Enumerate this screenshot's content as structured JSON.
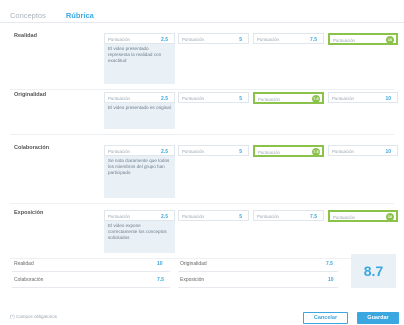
{
  "tabs": [
    {
      "label": "Conceptos"
    },
    {
      "label": "Rúbrica"
    }
  ],
  "criteria": [
    {
      "name": "Realidad",
      "levels": [
        {
          "label": "Puntuación",
          "value": "2.5",
          "desc": "El video presentado representa la realidad con exactitud"
        },
        {
          "label": "Puntuación",
          "value": "5"
        },
        {
          "label": "Puntuación",
          "value": "7.5"
        },
        {
          "label": "Puntuación",
          "value": "10"
        }
      ],
      "selected": 3
    },
    {
      "name": "Originalidad",
      "levels": [
        {
          "label": "Puntuación",
          "value": "2.5",
          "desc": "El video presentado es original"
        },
        {
          "label": "Puntuación",
          "value": "5"
        },
        {
          "label": "Puntuación",
          "value": "7.5"
        },
        {
          "label": "Puntuación",
          "value": "10"
        }
      ],
      "selected": 2
    },
    {
      "name": "Colaboración",
      "levels": [
        {
          "label": "Puntuación",
          "value": "2.5",
          "desc": "Se nota claramente que todos los miembros del grupo han participado"
        },
        {
          "label": "Puntuación",
          "value": "5"
        },
        {
          "label": "Puntuación",
          "value": "7.5"
        },
        {
          "label": "Puntuación",
          "value": "10"
        }
      ],
      "selected": 2
    },
    {
      "name": "Exposición",
      "levels": [
        {
          "label": "Puntuación",
          "value": "2.5",
          "desc": "El video expone correctamente los conceptos solicitados"
        },
        {
          "label": "Puntuación",
          "value": "5"
        },
        {
          "label": "Puntuación",
          "value": "7.5"
        },
        {
          "label": "Puntuación",
          "value": "10"
        }
      ],
      "selected": 3
    }
  ],
  "summary": {
    "rows": [
      {
        "left_name": "Realidad",
        "left_value": "10",
        "right_name": "Originalidad",
        "right_value": "7.5"
      },
      {
        "left_name": "Colaboración",
        "left_value": "7.5",
        "right_name": "Exposición",
        "right_value": "10"
      }
    ],
    "total": "8.7"
  },
  "footer": {
    "required_note": "(*) Campos obligatorios",
    "cancel_label": "Cancelar",
    "save_label": "Guardar"
  },
  "colors": {
    "accent": "#3aa7e0",
    "selected": "#8bc34a",
    "desc_bg": "#e9f1f7"
  }
}
